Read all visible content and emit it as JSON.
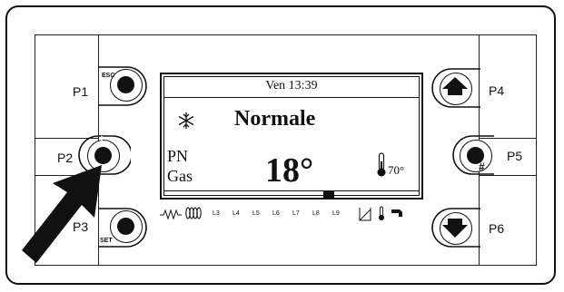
{
  "buttons": {
    "p1": {
      "label": "P1",
      "sub": "ESC"
    },
    "p2": {
      "label": "P2"
    },
    "p3": {
      "label": "P3",
      "sub": "SET"
    },
    "p4": {
      "label": "P4"
    },
    "p5": {
      "label": "P5",
      "sub": "#"
    },
    "p6": {
      "label": "P6"
    }
  },
  "display": {
    "datetime": "Ven 13:39",
    "mode": "Normale",
    "line1": "PN",
    "line2": "Gas",
    "temperature": "18°",
    "water_temp": "70°",
    "icons": {
      "mode_icon": "snowflake-icon",
      "water_icon": "thermometer-icon"
    }
  },
  "status_bar": {
    "indicators": [
      "L3",
      "L4",
      "L5",
      "L6",
      "L7",
      "L8",
      "L9"
    ],
    "icons": [
      "heating-coil-icon",
      "coil-icon",
      "tank-icon",
      "thermometer-small-icon",
      "tap-icon"
    ]
  },
  "colors": {
    "ink": "#111111",
    "background": "#ffffff"
  }
}
